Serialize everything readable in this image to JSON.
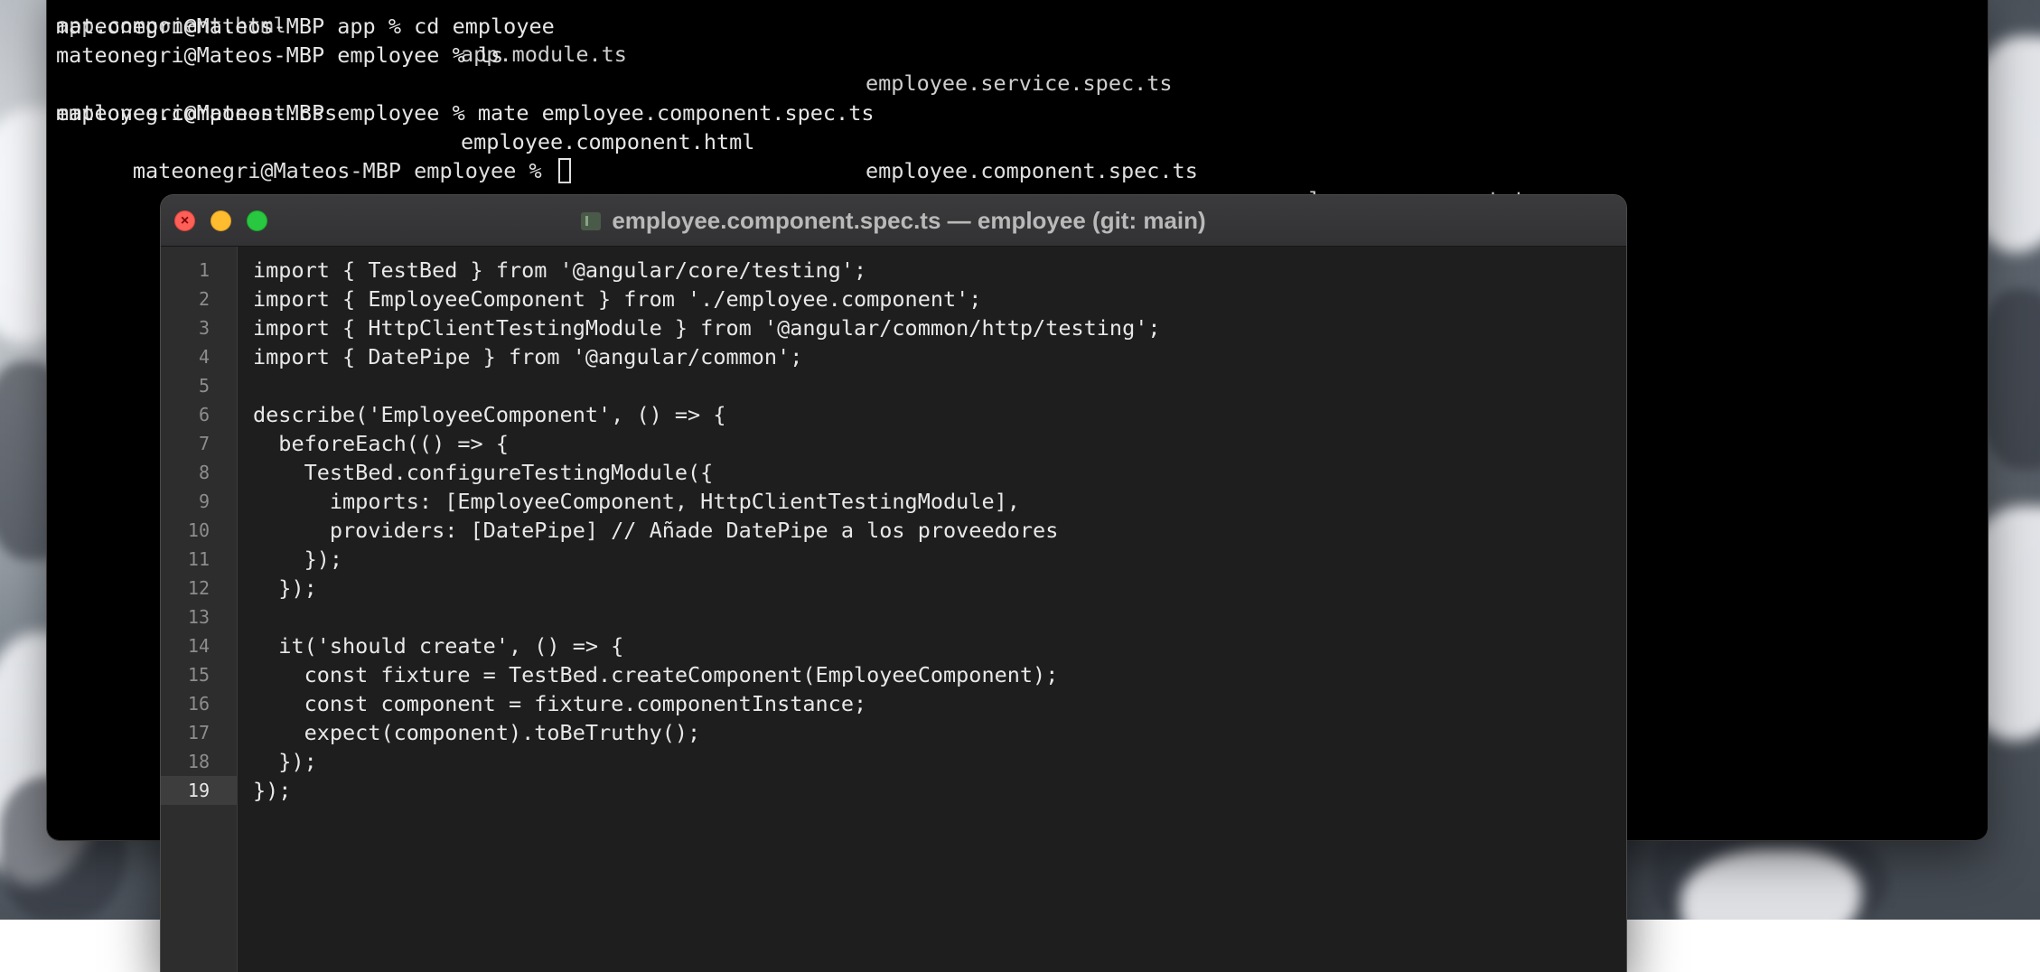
{
  "terminal": {
    "partial_top": [
      "app.component.html",
      "app.module.ts",
      "employee.service.spec.ts"
    ],
    "lines": [
      "mateonegri@Mateos-MBP app % cd employee",
      "mateonegri@Mateos-MBP employee % ls"
    ],
    "ls_output": [
      "employee.component.css",
      "employee.component.html",
      "employee.component.spec.ts",
      "employee.component.ts"
    ],
    "lines_after": [
      "mateonegri@Mateos-MBP employee % mate employee.component.spec.ts",
      "mateonegri@Mateos-MBP employee % "
    ]
  },
  "editor": {
    "title": "employee.component.spec.ts — employee (git: main)",
    "current_line": 19,
    "line_numbers": [
      "1",
      "2",
      "3",
      "4",
      "5",
      "6",
      "7",
      "8",
      "9",
      "10",
      "11",
      "12",
      "13",
      "14",
      "15",
      "16",
      "17",
      "18",
      "19"
    ],
    "code_lines": [
      "import { TestBed } from '@angular/core/testing';",
      "import { EmployeeComponent } from './employee.component';",
      "import { HttpClientTestingModule } from '@angular/common/http/testing';",
      "import { DatePipe } from '@angular/common';",
      "",
      "describe('EmployeeComponent', () => {",
      "  beforeEach(() => {",
      "    TestBed.configureTestingModule({",
      "      imports: [EmployeeComponent, HttpClientTestingModule],",
      "      providers: [DatePipe] // Añade DatePipe a los proveedores",
      "    });",
      "  });",
      "",
      "  it('should create', () => {",
      "    const fixture = TestBed.createComponent(EmployeeComponent);",
      "    const component = fixture.componentInstance;",
      "    expect(component).toBeTruthy();",
      "  });",
      "});"
    ]
  },
  "colors": {
    "terminal_bg": "#000000",
    "editor_bg": "#1e1e1e",
    "gutter_bg": "#2d2d2d",
    "close": "#fe5f57",
    "minimize": "#febc2e",
    "zoom": "#28c840"
  },
  "icons": {
    "file": "file-icon",
    "close": "close-icon",
    "minimize": "minimize-icon",
    "zoom": "zoom-icon"
  }
}
